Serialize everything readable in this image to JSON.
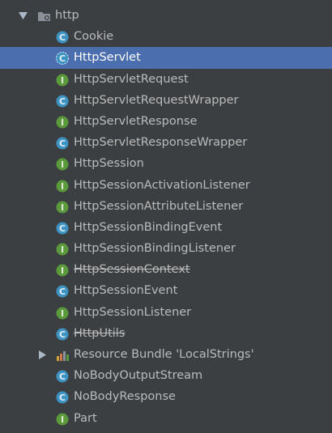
{
  "tree": {
    "package": {
      "label": "http",
      "icon": "package-folder-icon",
      "expanded": true
    },
    "items": [
      {
        "label": "Cookie",
        "kind": "class",
        "icon": "class-icon"
      },
      {
        "label": "HttpServlet",
        "kind": "class-abstract",
        "icon": "abstract-class-icon",
        "selected": true
      },
      {
        "label": "HttpServletRequest",
        "kind": "interface",
        "icon": "interface-icon"
      },
      {
        "label": "HttpServletRequestWrapper",
        "kind": "class",
        "icon": "class-icon"
      },
      {
        "label": "HttpServletResponse",
        "kind": "interface",
        "icon": "interface-icon"
      },
      {
        "label": "HttpServletResponseWrapper",
        "kind": "class",
        "icon": "class-icon"
      },
      {
        "label": "HttpSession",
        "kind": "interface",
        "icon": "interface-icon"
      },
      {
        "label": "HttpSessionActivationListener",
        "kind": "interface",
        "icon": "interface-icon"
      },
      {
        "label": "HttpSessionAttributeListener",
        "kind": "interface",
        "icon": "interface-icon"
      },
      {
        "label": "HttpSessionBindingEvent",
        "kind": "class",
        "icon": "class-icon"
      },
      {
        "label": "HttpSessionBindingListener",
        "kind": "interface",
        "icon": "interface-icon"
      },
      {
        "label": "HttpSessionContext",
        "kind": "interface",
        "icon": "interface-icon",
        "deprecated": true
      },
      {
        "label": "HttpSessionEvent",
        "kind": "class",
        "icon": "class-icon"
      },
      {
        "label": "HttpSessionListener",
        "kind": "interface",
        "icon": "interface-icon"
      },
      {
        "label": "HttpUtils",
        "kind": "class",
        "icon": "class-icon",
        "deprecated": true
      },
      {
        "label": "Resource Bundle 'LocalStrings'",
        "kind": "bundle",
        "icon": "resource-bundle-icon",
        "collapsed": true
      },
      {
        "label": "NoBodyOutputStream",
        "kind": "class",
        "icon": "class-icon"
      },
      {
        "label": "NoBodyResponse",
        "kind": "class",
        "icon": "class-icon"
      },
      {
        "label": "Part",
        "kind": "interface",
        "icon": "interface-icon"
      }
    ]
  },
  "colors": {
    "background": "#3c3f41",
    "selection": "#4b6eaf",
    "text": "#bbbbbb",
    "class_icon": "#3d94c2",
    "interface_icon": "#5b9a3c",
    "package_icon": "#8a9199"
  }
}
